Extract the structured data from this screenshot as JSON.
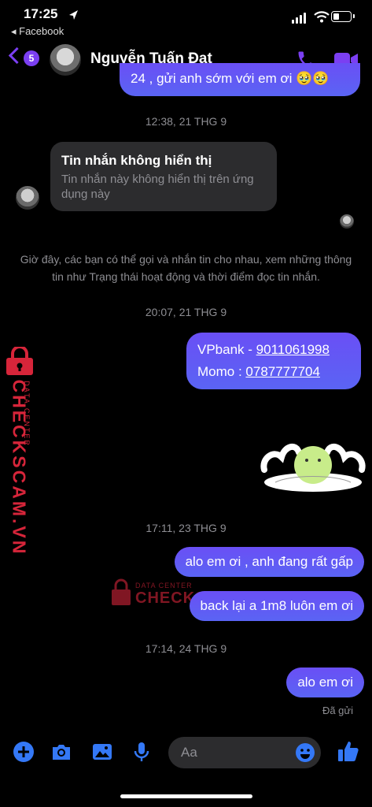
{
  "status_bar": {
    "time": "17:25",
    "back_app": "◂ Facebook"
  },
  "header": {
    "back_badge": "5",
    "contact_name": "Nguyễn Tuấn Đạt"
  },
  "messages": {
    "top_partial": "24 , gửi anh sớm với em ơi 🥹🥹",
    "ts1": "12:38, 21 THG 9",
    "hidden_title": "Tin nhắn không hiển thị",
    "hidden_body": "Tin nhắn này không hiển thị trên ứng dụng này",
    "system_info": "Giờ đây, các bạn có thể gọi và nhắn tin cho nhau, xem những thông tin như Trạng thái hoạt động và thời điểm đọc tin nhắn.",
    "ts2": "20:07, 21 THG 9",
    "bank_prefix": "VPbank - ",
    "bank_number": "9011061998",
    "momo_prefix": "Momo : ",
    "momo_number": "0787777704",
    "ts3": "17:11, 23 THG 9",
    "msg_alo_gap": "alo em ơi , anh đang rất gấp",
    "msg_back": "back lại a 1m8 luôn em ơi",
    "ts4": "17:14, 24 THG 9",
    "msg_alo": "alo em ơi",
    "sent_status": "Đã gửi"
  },
  "watermark": {
    "brand": "CHECKSCAM.VN",
    "tag": "DATA CENTER"
  },
  "composer": {
    "placeholder": "Aa"
  },
  "colors": {
    "accent": "#7b3ff2",
    "bubble": "#5a5ef4",
    "watermark": "#d6253a"
  }
}
